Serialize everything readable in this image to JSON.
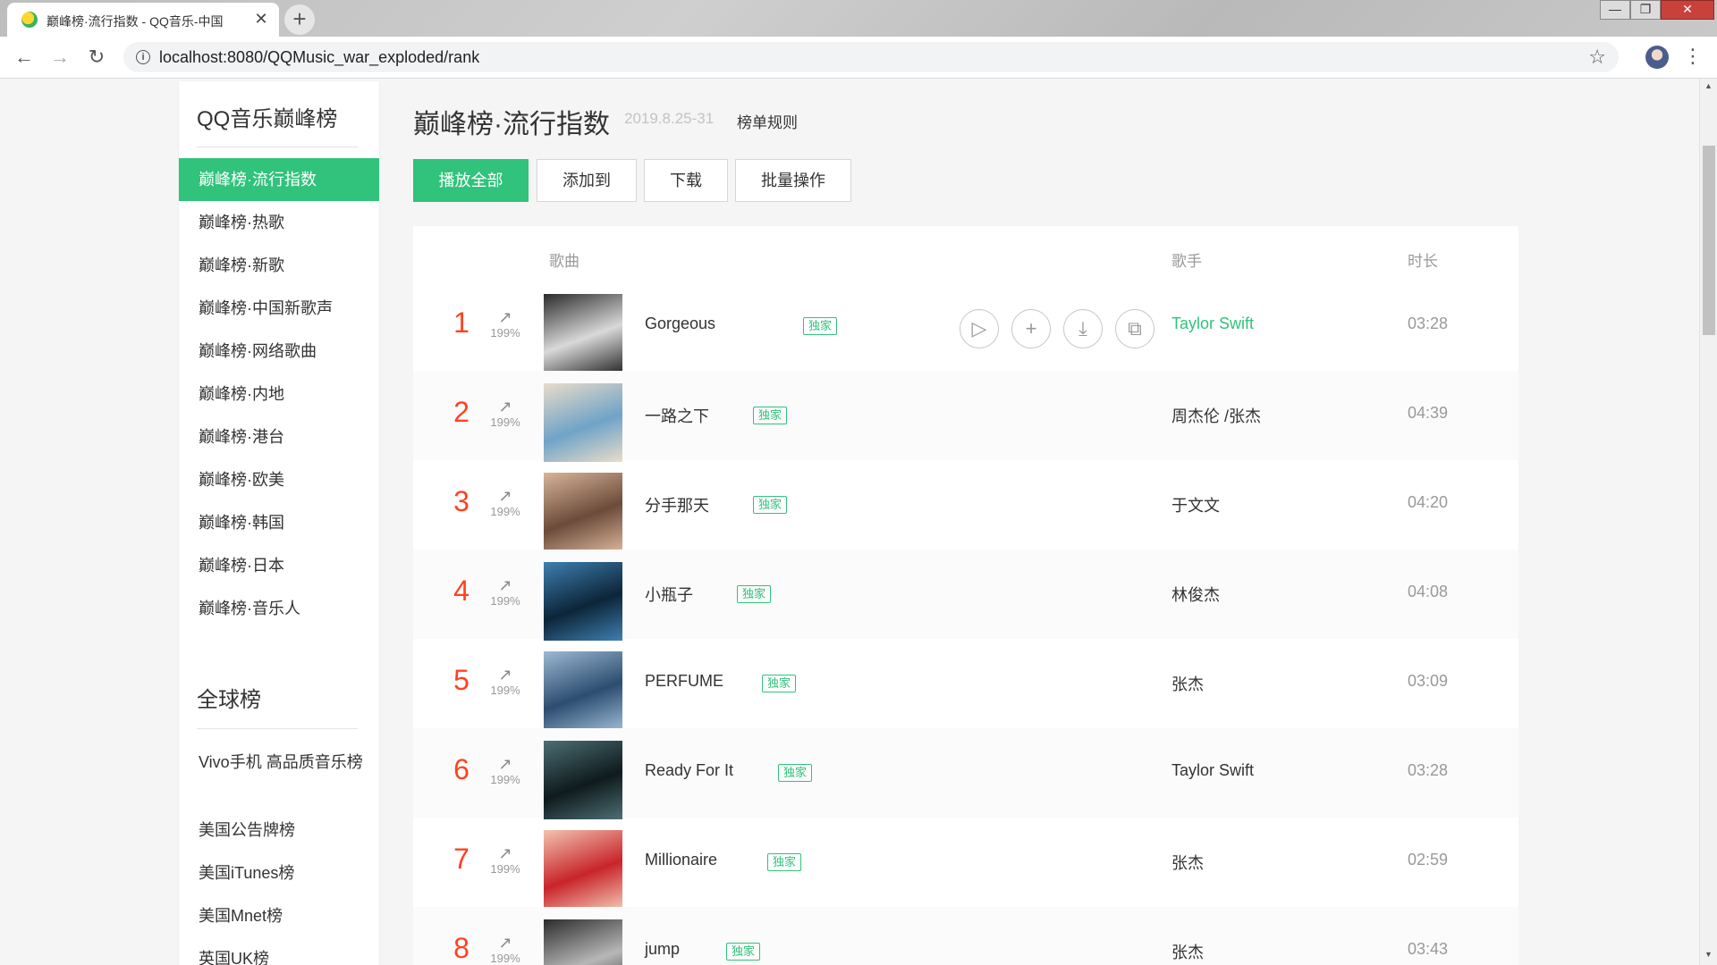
{
  "browser": {
    "tab_title": "巅峰榜·流行指数 - QQ音乐-中国",
    "tab_close": "✕",
    "new_tab": "+",
    "url": "localhost:8080/QQMusic_war_exploded/rank",
    "info": "i",
    "back": "←",
    "forward": "→",
    "reload": "↻",
    "bookmark": "☆",
    "menu": "⋮",
    "win_min": "—",
    "win_max": "❐",
    "win_close": "✕"
  },
  "sidebar": {
    "section1_title": "QQ音乐巅峰榜",
    "items": [
      "巅峰榜·流行指数",
      "巅峰榜·热歌",
      "巅峰榜·新歌",
      "巅峰榜·中国新歌声",
      "巅峰榜·网络歌曲",
      "巅峰榜·内地",
      "巅峰榜·港台",
      "巅峰榜·欧美",
      "巅峰榜·韩国",
      "巅峰榜·日本",
      "巅峰榜·音乐人"
    ],
    "active_index": 0,
    "section2_title": "全球榜",
    "global_items": [
      "Vivo手机 高品质音乐榜",
      "美国公告牌榜",
      "美国iTunes榜",
      "美国Mnet榜",
      "英国UK榜"
    ]
  },
  "header": {
    "title": "巅峰榜·流行指数",
    "date": "2019.8.25-31",
    "rules": "榜单规则"
  },
  "actions": {
    "play_all": "播放全部",
    "add_to": "添加到",
    "download": "下载",
    "batch": "批量操作"
  },
  "columns": {
    "song": "歌曲",
    "singer": "歌手",
    "duration": "时长"
  },
  "badge_label": "独家",
  "trend_arrow": "↗",
  "hover_actions": {
    "play": "▷",
    "add": "+",
    "download": "⤓",
    "share": "⧉"
  },
  "songs": [
    {
      "rank": "1",
      "trend": "199%",
      "title": "Gorgeous",
      "singer": "Taylor Swift",
      "duration": "03:28",
      "cover_color": "#d9d9d9",
      "cover_accent": "#2b2b2b"
    },
    {
      "rank": "2",
      "trend": "199%",
      "title": "一路之下",
      "singer": "周杰伦 /张杰",
      "duration": "04:39",
      "cover_color": "#6fa3c8",
      "cover_accent": "#e9dcc9"
    },
    {
      "rank": "3",
      "trend": "199%",
      "title": "分手那天",
      "singer": "于文文",
      "duration": "04:20",
      "cover_color": "#6b4b3a",
      "cover_accent": "#d8b49a"
    },
    {
      "rank": "4",
      "trend": "199%",
      "title": "小瓶子",
      "singer": "林俊杰",
      "duration": "04:08",
      "cover_color": "#0c2538",
      "cover_accent": "#3f7fb0"
    },
    {
      "rank": "5",
      "trend": "199%",
      "title": "PERFUME",
      "singer": "张杰",
      "duration": "03:09",
      "cover_color": "#2b4d70",
      "cover_accent": "#9db9d3"
    },
    {
      "rank": "6",
      "trend": "199%",
      "title": "Ready For It",
      "singer": "Taylor Swift",
      "duration": "03:28",
      "cover_color": "#0f1a1c",
      "cover_accent": "#4c6e74"
    },
    {
      "rank": "7",
      "trend": "199%",
      "title": "Millionaire",
      "singer": "张杰",
      "duration": "02:59",
      "cover_color": "#c8242a",
      "cover_accent": "#f2c3b0"
    },
    {
      "rank": "8",
      "trend": "199%",
      "title": "jump",
      "singer": "张杰",
      "duration": "03:43",
      "cover_color": "#b7b7b7",
      "cover_accent": "#2c2c2c"
    }
  ],
  "colors": {
    "accent": "#31c27c",
    "rank": "#ff4222"
  }
}
